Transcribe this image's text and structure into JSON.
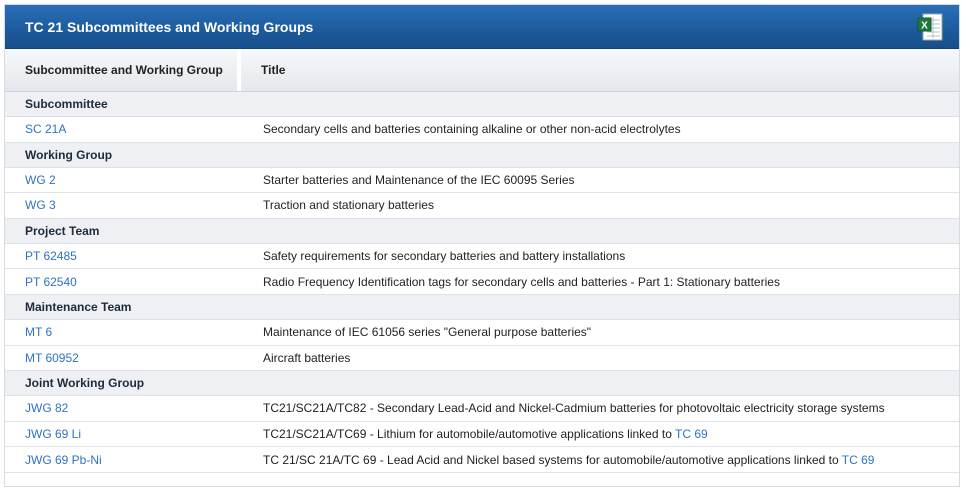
{
  "header": {
    "title": "TC 21 Subcommittees and Working Groups",
    "export_icon": "excel-export-icon"
  },
  "columns": {
    "col1": "Subcommittee and Working Group",
    "col2": "Title"
  },
  "sections": [
    {
      "label": "Subcommittee",
      "rows": [
        {
          "code": "SC 21A",
          "title": "Secondary cells and batteries containing alkaline or other non-acid electrolytes"
        }
      ]
    },
    {
      "label": "Working Group",
      "rows": [
        {
          "code": "WG 2",
          "title": "Starter batteries and Maintenance of the IEC 60095 Series"
        },
        {
          "code": "WG 3",
          "title": "Traction and stationary batteries"
        }
      ]
    },
    {
      "label": "Project Team",
      "rows": [
        {
          "code": "PT 62485",
          "title": "Safety requirements for secondary batteries and battery installations"
        },
        {
          "code": "PT 62540",
          "title": "Radio Frequency Identification tags for secondary cells and batteries - Part 1: Stationary batteries"
        }
      ]
    },
    {
      "label": "Maintenance Team",
      "rows": [
        {
          "code": "MT 6",
          "title": "Maintenance of IEC 61056 series \"General purpose batteries\""
        },
        {
          "code": "MT 60952",
          "title": "Aircraft batteries"
        }
      ]
    },
    {
      "label": "Joint Working Group",
      "rows": [
        {
          "code": "JWG 82",
          "title": "TC21/SC21A/TC82 - Secondary Lead-Acid and Nickel-Cadmium batteries for photovoltaic electricity storage systems"
        },
        {
          "code": "JWG 69 Li",
          "title": "TC21/SC21A/TC69 - Lithium for automobile/automotive applications linked to ",
          "link": "TC 69"
        },
        {
          "code": "JWG 69 Pb-Ni",
          "title": "TC 21/SC 21A/TC 69 - Lead Acid and Nickel based systems for automobile/automotive applications linked to ",
          "link": "TC 69"
        }
      ]
    }
  ],
  "colors": {
    "header_bg": "#1d5c9e",
    "link": "#2e73c4",
    "section_bg": "#eef0f4"
  }
}
